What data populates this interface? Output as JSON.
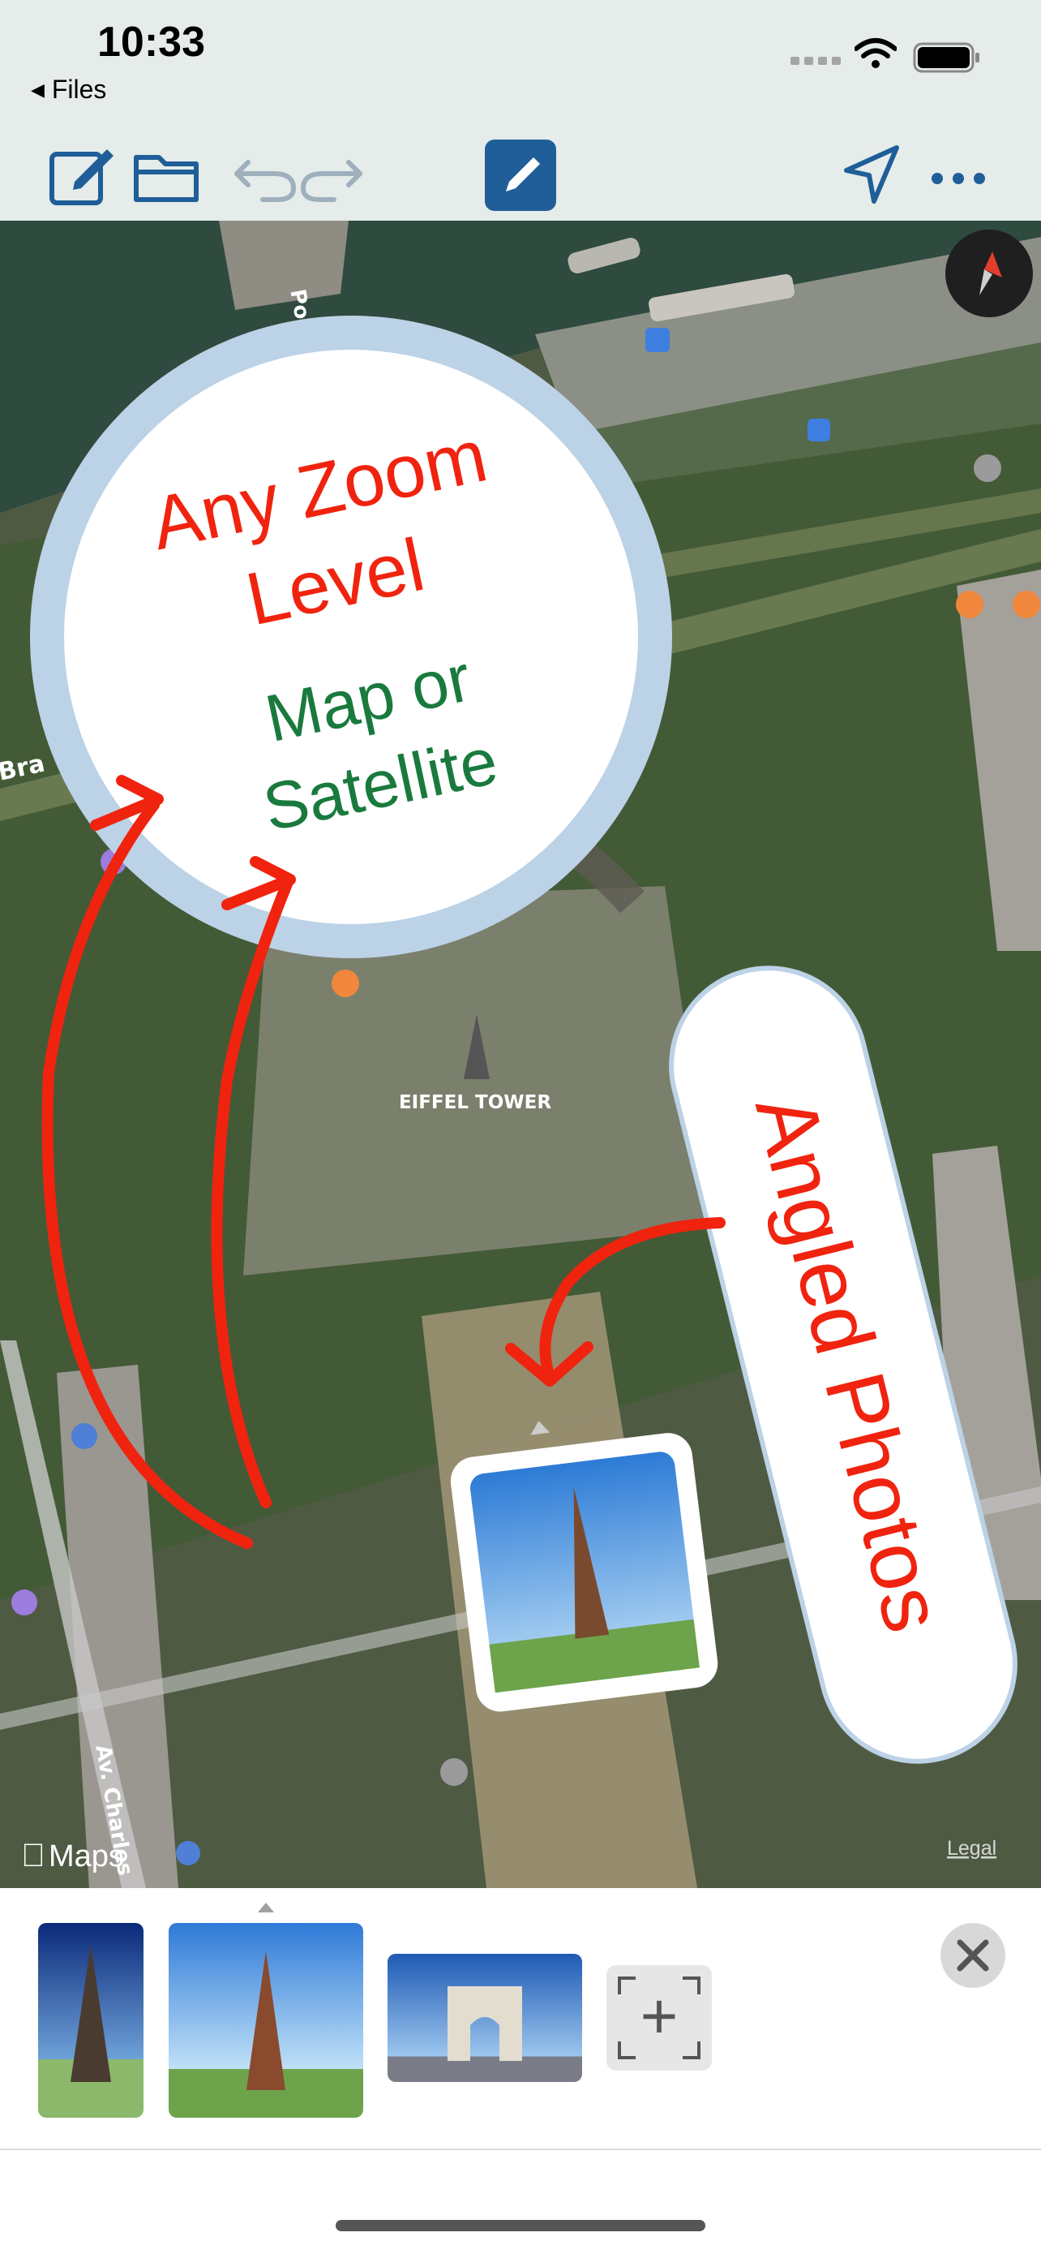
{
  "status_bar": {
    "time": "10:33",
    "back_label": "Files"
  },
  "toolbar": {
    "new_note_icon": "compose-icon",
    "folder_icon": "folder-icon",
    "undo_icon": "undo-icon",
    "redo_icon": "redo-icon",
    "pencil_icon": "pencil-icon",
    "location_icon": "location-arrow-icon",
    "more_icon": "ellipsis-icon",
    "accent_color": "#1f5e99"
  },
  "map": {
    "compass": "compass-icon",
    "labels": {
      "eiffel": "EIFFEL TOWER",
      "road_top": "Po",
      "road_left": "Bra",
      "road_bottom": "Av. Charles",
      "attribution": "Maps",
      "legal": "Legal"
    },
    "callouts": {
      "zoom_line1": "Any Zoom",
      "zoom_line2": "Level",
      "map_line1": "Map or",
      "map_line2": "Satellite",
      "angled": "Angled Photos"
    },
    "colors": {
      "callout_red": "#f0230f",
      "callout_green": "#1a7a3e",
      "ring": "#bcd2e6"
    }
  },
  "photo_tray": {
    "thumbnails": [
      "eiffel-tower-night-sky",
      "eiffel-tower-lawn",
      "arc-de-triomphe"
    ],
    "add_label": "+",
    "close_icon": "close-icon"
  }
}
